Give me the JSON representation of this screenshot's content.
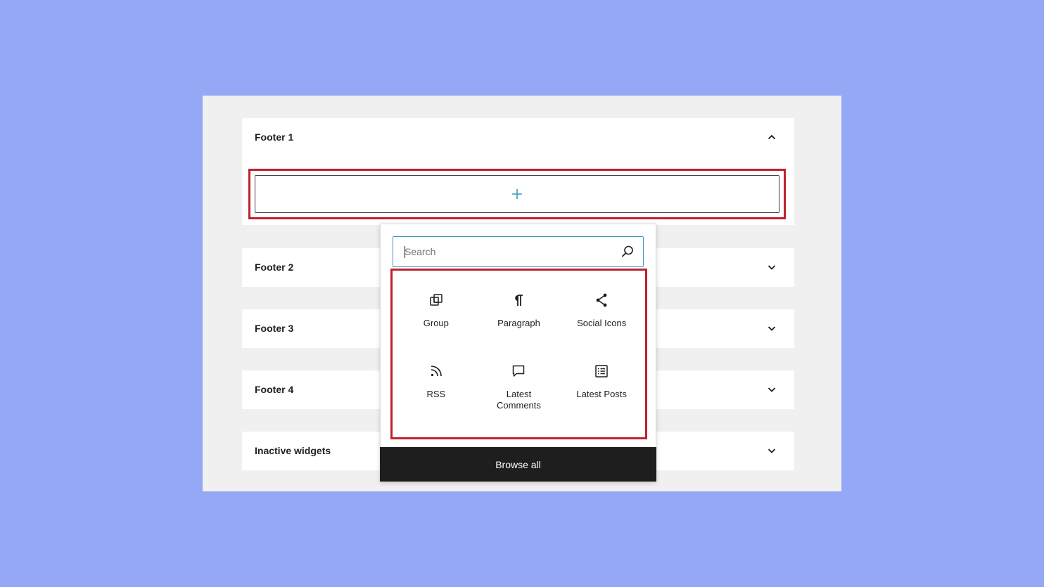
{
  "colors": {
    "background": "#94a8f5",
    "highlight": "#c0202e",
    "accent": "#3b98c3",
    "dark": "#1e1e1e"
  },
  "footers": [
    {
      "title": "Footer 1",
      "state": "expanded",
      "icon": "chevron-up-icon"
    },
    {
      "title": "Footer 2",
      "state": "collapsed",
      "icon": "chevron-down-icon"
    },
    {
      "title": "Footer 3",
      "state": "collapsed",
      "icon": "chevron-down-icon"
    },
    {
      "title": "Footer 4",
      "state": "collapsed",
      "icon": "chevron-down-icon"
    },
    {
      "title": "Inactive widgets",
      "state": "collapsed",
      "icon": "chevron-down-icon"
    }
  ],
  "add_block": {
    "icon": "plus-icon"
  },
  "inserter": {
    "search": {
      "placeholder": "Search",
      "value": "",
      "icon": "search-icon"
    },
    "blocks": [
      {
        "label": "Group",
        "icon": "group-icon"
      },
      {
        "label": "Paragraph",
        "icon": "paragraph-icon"
      },
      {
        "label": "Social Icons",
        "icon": "share-icon"
      },
      {
        "label": "RSS",
        "icon": "rss-icon"
      },
      {
        "label": "Latest Comments",
        "icon": "comment-icon"
      },
      {
        "label": "Latest Posts",
        "icon": "list-icon"
      }
    ],
    "browse_all_label": "Browse all"
  }
}
